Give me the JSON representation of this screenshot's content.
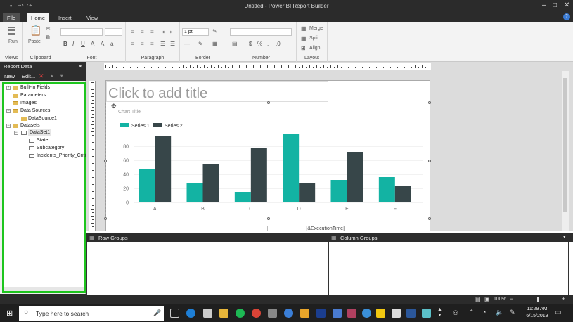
{
  "window": {
    "title": "Untitled - Power BI Report Builder"
  },
  "ribbon": {
    "tabs": [
      "File",
      "Home",
      "Insert",
      "View"
    ],
    "groups": {
      "views": "Views",
      "clipboard": "Clipboard",
      "font": "Font",
      "paragraph": "Paragraph",
      "border": "Border",
      "number": "Number",
      "layout": "Layout"
    },
    "run_label": "Run",
    "paste_label": "Paste",
    "border_width": "1 pt",
    "merge_label": "Merge",
    "split_label": "Split",
    "align_label": "Align"
  },
  "report_data": {
    "title": "Report Data",
    "toolbar": {
      "new": "New",
      "edit": "Edit..."
    },
    "tree": {
      "builtin": "Built-in Fields",
      "parameters": "Parameters",
      "images": "Images",
      "data_sources": "Data Sources",
      "data_source1": "DataSource1",
      "datasets": "Datasets",
      "dataset1": "DataSet1",
      "fields": [
        "State",
        "Subcategory",
        "Incidents_Priority_Criti"
      ]
    }
  },
  "design": {
    "title_placeholder": "Click to add title",
    "execution_time": "[&ExecutionTime]"
  },
  "chart_data": {
    "type": "bar",
    "title": "Chart Title",
    "categories": [
      "A",
      "B",
      "C",
      "D",
      "E",
      "F"
    ],
    "series": [
      {
        "name": "Series 1",
        "values": [
          48,
          28,
          15,
          97,
          32,
          36
        ],
        "color": "#13b3a3"
      },
      {
        "name": "Series 2",
        "values": [
          95,
          55,
          78,
          27,
          72,
          24
        ],
        "color": "#374649"
      }
    ],
    "yticks": [
      "0",
      "20",
      "40",
      "60",
      "80"
    ],
    "ylim": [
      0,
      100
    ],
    "legend": "top-left"
  },
  "groups": {
    "row": "Row Groups",
    "column": "Column Groups"
  },
  "status": {
    "zoom": "100%"
  },
  "taskbar": {
    "search_placeholder": "Type here to search",
    "time": "11:29 AM",
    "date": "6/15/2019"
  }
}
